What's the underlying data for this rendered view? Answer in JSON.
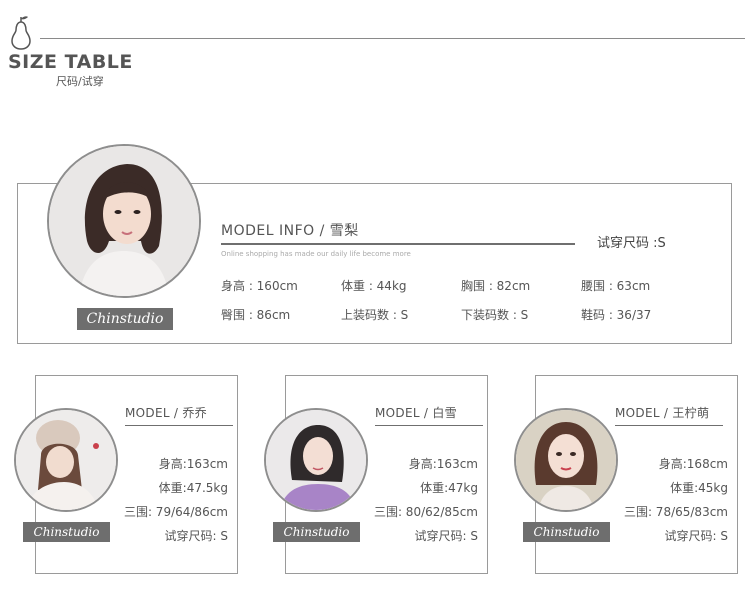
{
  "header": {
    "title": "SIZE TABLE",
    "subtitle": "尺码/试穿"
  },
  "main_model": {
    "title": "MODEL INFO / 雪梨",
    "caption": "Online shopping has made our daily life become more",
    "tryon": "试穿尺码 :S",
    "logo": "Chinstudio",
    "stats_row1": [
      "身高 : 160cm",
      "体重 : 44kg",
      "胸围 : 82cm",
      "腰围 : 63cm"
    ],
    "stats_row2": [
      "臀围 : 86cm",
      "上装码数 : S",
      "下装码数 : S",
      "鞋码 : 36/37"
    ]
  },
  "models": [
    {
      "title": "MODEL  /  乔乔",
      "height": "身高:163cm",
      "weight": "体重:47.5kg",
      "bwh": "三围: 79/64/86cm",
      "tryon": "试穿尺码: S",
      "logo": "Chinstudio"
    },
    {
      "title": "MODEL  /  白雪",
      "height": "身高:163cm",
      "weight": "体重:47kg",
      "bwh": "三围: 80/62/85cm",
      "tryon": "试穿尺码: S",
      "logo": "Chinstudio"
    },
    {
      "title": "MODEL / 王柠萌",
      "height": "身高:168cm",
      "weight": "体重:45kg",
      "bwh": "三围: 78/65/83cm",
      "tryon": "试穿尺码: S",
      "logo": "Chinstudio"
    }
  ]
}
